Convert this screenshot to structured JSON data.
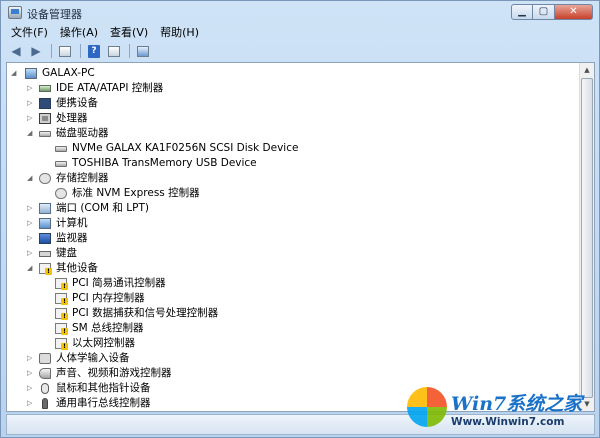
{
  "window": {
    "title": "设备管理器",
    "buttons": {
      "minimize": "▁",
      "maximize": "▢",
      "close": "✕"
    }
  },
  "menu": [
    "文件(F)",
    "操作(A)",
    "查看(V)",
    "帮助(H)"
  ],
  "toolbar": {
    "icons": [
      "back-arrow-icon",
      "forward-arrow-icon",
      "properties-icon",
      "help-icon",
      "view-icon",
      "scan-hardware-icon"
    ],
    "help_glyph": "?"
  },
  "tree": {
    "root": "GALAX-PC",
    "nodes": [
      {
        "label": "IDE ATA/ATAPI 控制器",
        "icon": "ide-icon",
        "expanded": false
      },
      {
        "label": "便携设备",
        "icon": "portable-device-icon",
        "expanded": false
      },
      {
        "label": "处理器",
        "icon": "processor-icon",
        "expanded": false
      },
      {
        "label": "磁盘驱动器",
        "icon": "disk-drive-icon",
        "expanded": true,
        "children": [
          {
            "label": "NVMe GALAX KA1F0256N SCSI Disk Device",
            "icon": "disk-icon"
          },
          {
            "label": "TOSHIBA TransMemory USB Device",
            "icon": "disk-icon"
          }
        ]
      },
      {
        "label": "存储控制器",
        "icon": "storage-controller-icon",
        "expanded": true,
        "children": [
          {
            "label": "标准 NVM Express 控制器",
            "icon": "storage-controller-icon"
          }
        ]
      },
      {
        "label": "端口 (COM 和 LPT)",
        "icon": "port-icon",
        "expanded": false
      },
      {
        "label": "计算机",
        "icon": "computer-icon",
        "expanded": false
      },
      {
        "label": "监视器",
        "icon": "monitor-icon",
        "expanded": false
      },
      {
        "label": "键盘",
        "icon": "keyboard-icon",
        "expanded": false
      },
      {
        "label": "其他设备",
        "icon": "other-devices-icon",
        "expanded": true,
        "children": [
          {
            "label": "PCI 简易通讯控制器",
            "icon": "warning-device-icon"
          },
          {
            "label": "PCI 内存控制器",
            "icon": "warning-device-icon"
          },
          {
            "label": "PCI 数据捕获和信号处理控制器",
            "icon": "warning-device-icon"
          },
          {
            "label": "SM 总线控制器",
            "icon": "warning-device-icon"
          },
          {
            "label": "以太网控制器",
            "icon": "warning-device-icon"
          }
        ]
      },
      {
        "label": "人体学输入设备",
        "icon": "hid-icon",
        "expanded": false
      },
      {
        "label": "声音、视频和游戏控制器",
        "icon": "sound-icon",
        "expanded": false
      },
      {
        "label": "鼠标和其他指针设备",
        "icon": "mouse-icon",
        "expanded": false
      },
      {
        "label": "通用串行总线控制器",
        "icon": "usb-icon",
        "expanded": false
      }
    ]
  },
  "watermark": {
    "brand": "Win7系统之家",
    "url": "Www.Winwin7.com"
  },
  "glyphs": {
    "collapsed": "▷",
    "expanded": "◢",
    "scroll_up": "▲",
    "scroll_down": "▼"
  }
}
